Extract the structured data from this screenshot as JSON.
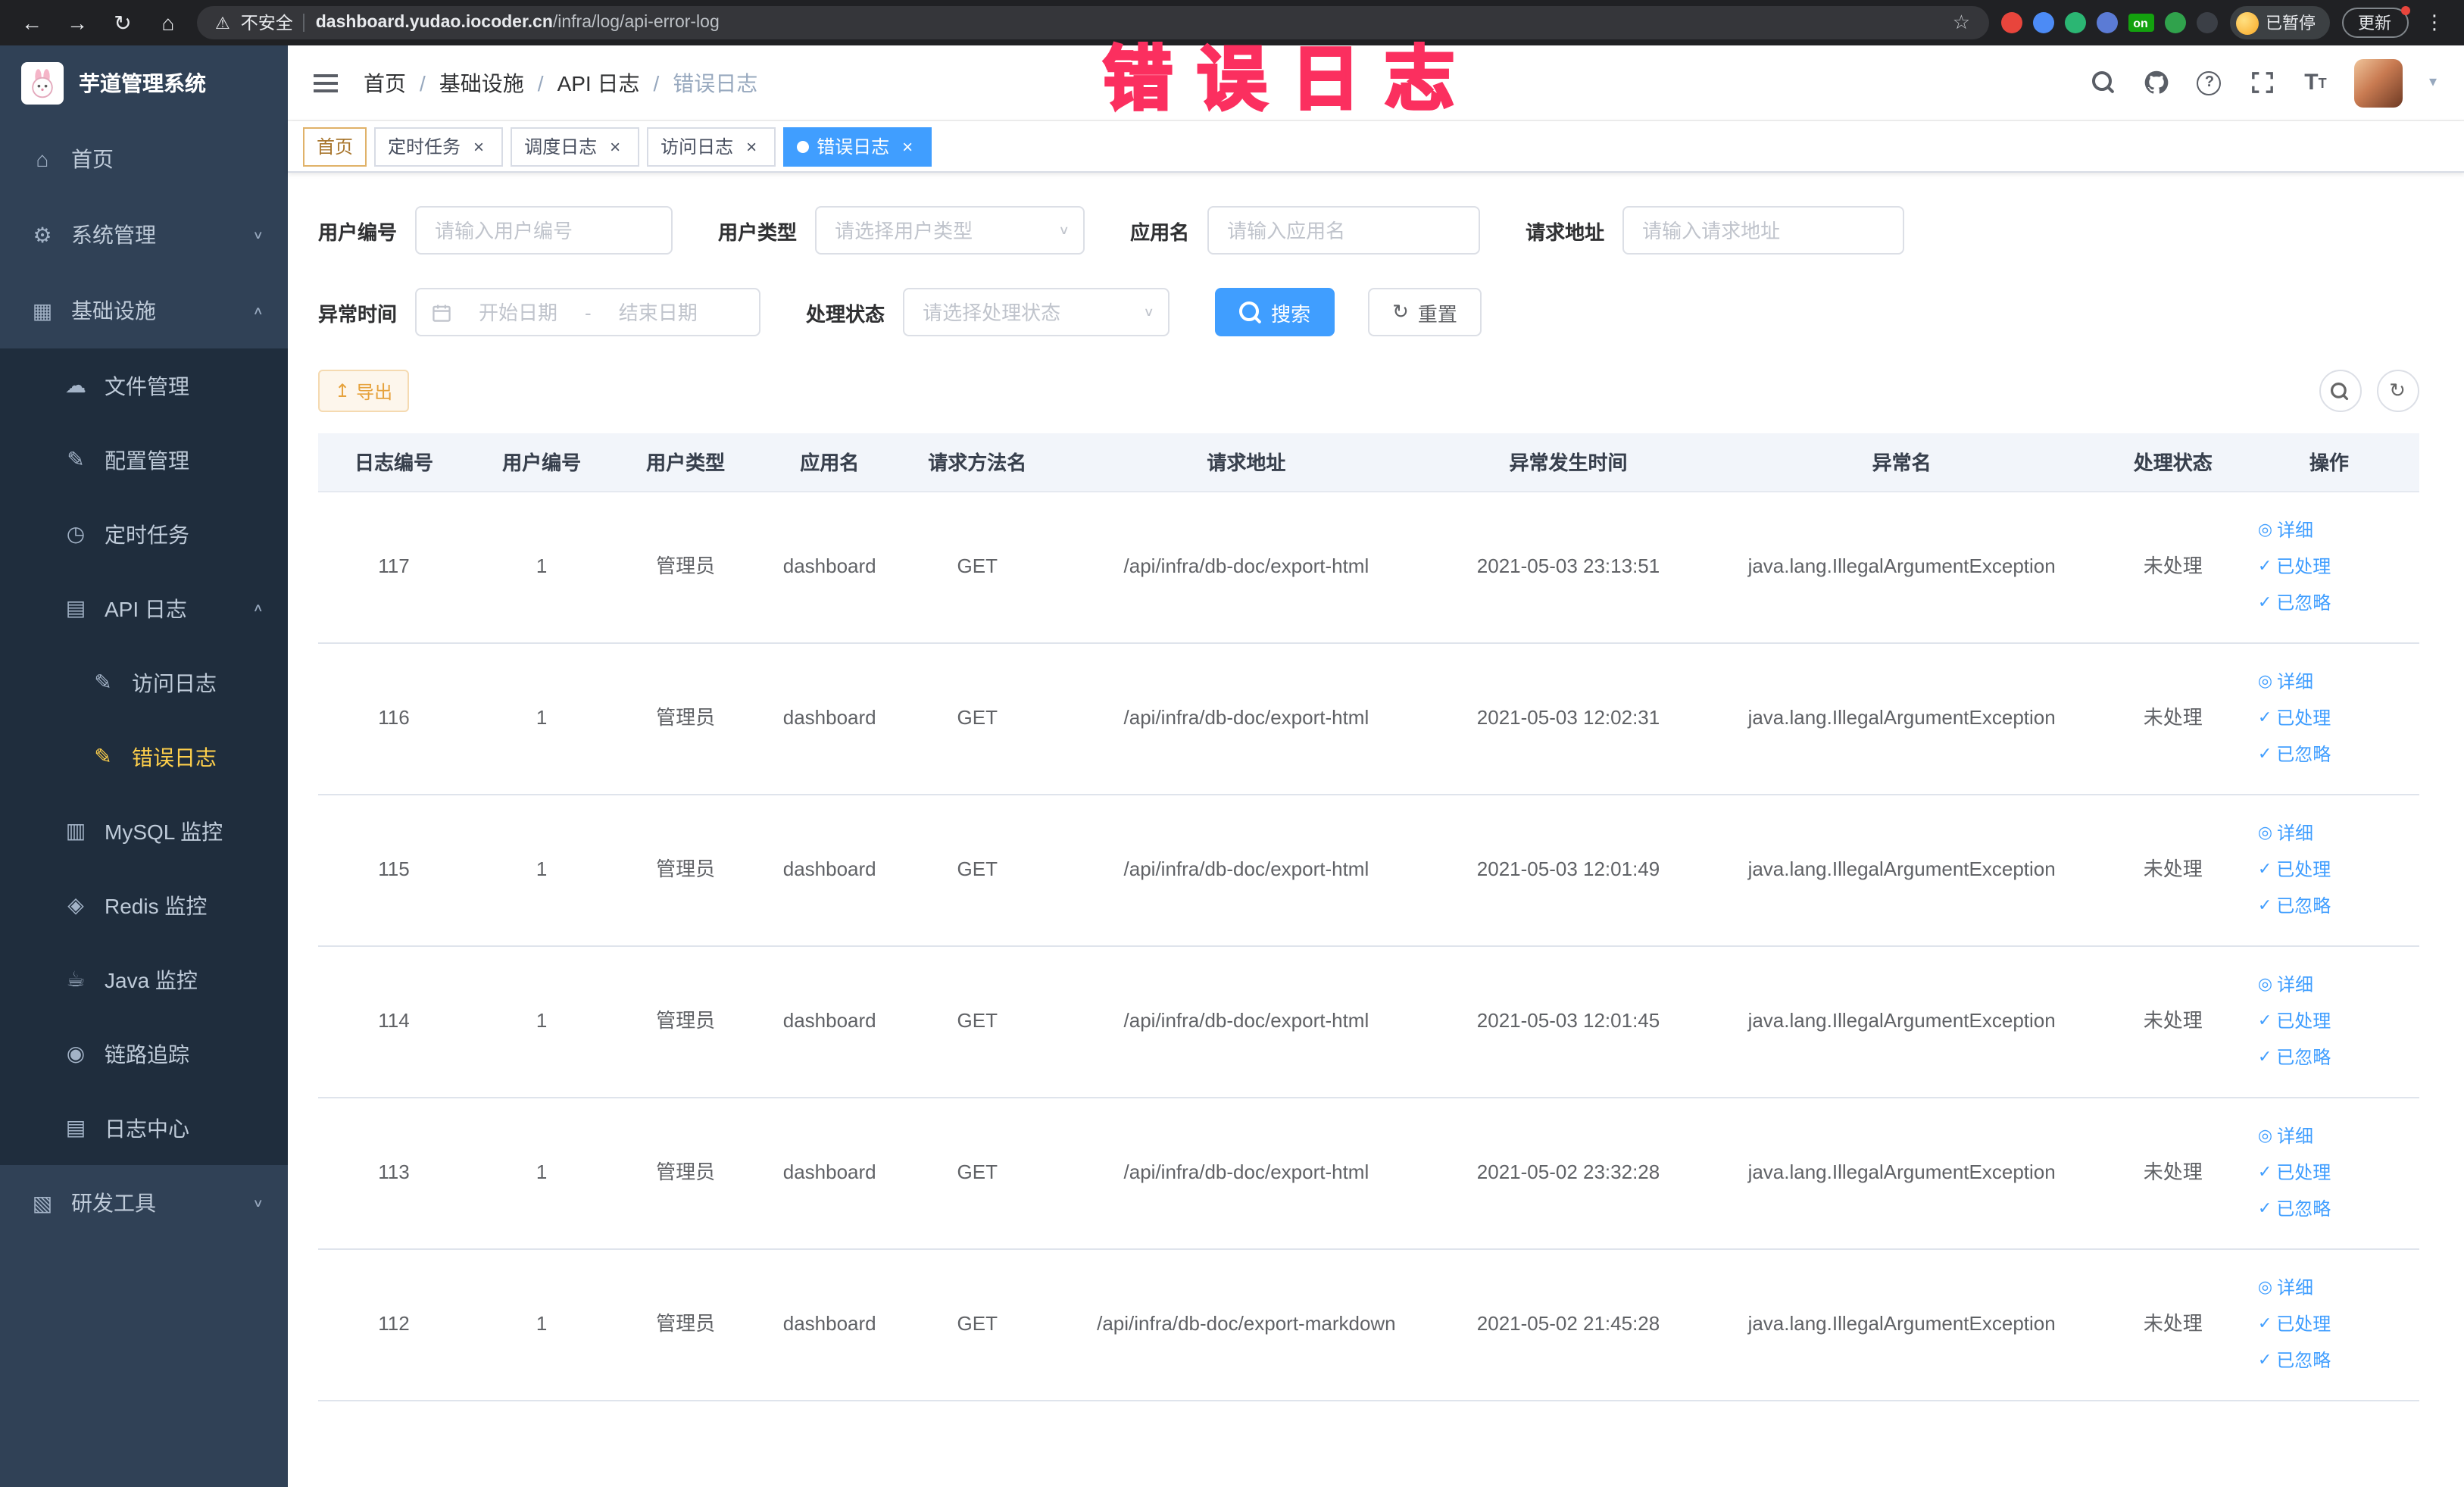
{
  "annotation": {
    "text": "错误日志",
    "color": "#fb2f5f"
  },
  "browser": {
    "security_label": "不安全",
    "url_host": "dashboard.yudao.iocoder.cn",
    "url_path": "/infra/log/api-error-log",
    "profile_badge": "已暂停",
    "update_label": "更新",
    "extension_on_badge": "on"
  },
  "icon_glyphs": {
    "back-icon": "←",
    "forward-icon": "→",
    "reload-icon": "↻",
    "browser-home-icon": "⌂",
    "warning-icon": "⚠",
    "star-icon": "☆",
    "more-icon": "⋮",
    "home-icon": "⌂",
    "gear-icon": "⚙",
    "infra-icon": "▦",
    "cloud-icon": "☁",
    "edit-icon": "✎",
    "timer-icon": "◷",
    "api-log-icon": "▤",
    "doc-icon": "✎",
    "mysql-icon": "▥",
    "redis-icon": "◈",
    "java-icon": "☕",
    "trace-icon": "◉",
    "log-center-icon": "▤",
    "tools-icon": "▧",
    "chevron-up-icon": "∧",
    "chevron-down-icon": "∨",
    "caret-down-icon": "▾",
    "help-icon": "?",
    "fontsize-icon": "T",
    "eye-icon": "◎",
    "check-icon": "✓",
    "refresh-icon": "↻",
    "export-icon": "↥",
    "close-icon": "×"
  },
  "sidebar": {
    "app_title": "芋道管理系统",
    "menu": [
      {
        "id": "home",
        "label": "首页",
        "icon": "home-icon",
        "level": 0
      },
      {
        "id": "system",
        "label": "系统管理",
        "icon": "gear-icon",
        "level": 0,
        "chevron": "down"
      },
      {
        "id": "infra",
        "label": "基础设施",
        "icon": "infra-icon",
        "level": 0,
        "chevron": "up"
      },
      {
        "id": "file",
        "label": "文件管理",
        "icon": "cloud-icon",
        "level": 1
      },
      {
        "id": "config",
        "label": "配置管理",
        "icon": "edit-icon",
        "level": 1
      },
      {
        "id": "job",
        "label": "定时任务",
        "icon": "timer-icon",
        "level": 1
      },
      {
        "id": "api-log",
        "label": "API 日志",
        "icon": "api-log-icon",
        "level": 1,
        "chevron": "up"
      },
      {
        "id": "access-log",
        "label": "访问日志",
        "icon": "doc-icon",
        "level": 2
      },
      {
        "id": "error-log",
        "label": "错误日志",
        "icon": "doc-icon",
        "level": 2,
        "active": true
      },
      {
        "id": "mysql",
        "label": "MySQL 监控",
        "icon": "mysql-icon",
        "level": 1
      },
      {
        "id": "redis",
        "label": "Redis 监控",
        "icon": "redis-icon",
        "level": 1
      },
      {
        "id": "java",
        "label": "Java 监控",
        "icon": "java-icon",
        "level": 1
      },
      {
        "id": "trace",
        "label": "链路追踪",
        "icon": "trace-icon",
        "level": 1
      },
      {
        "id": "log-center",
        "label": "日志中心",
        "icon": "log-center-icon",
        "level": 1
      },
      {
        "id": "dev-tools",
        "label": "研发工具",
        "icon": "tools-icon",
        "level": 0,
        "chevron": "down"
      }
    ]
  },
  "header": {
    "breadcrumb": [
      "首页",
      "基础设施",
      "API 日志",
      "错误日志"
    ]
  },
  "tags": [
    {
      "id": "home",
      "label": "首页",
      "closable": false,
      "active": false,
      "accent": true
    },
    {
      "id": "job",
      "label": "定时任务",
      "closable": true,
      "active": false
    },
    {
      "id": "job-log",
      "label": "调度日志",
      "closable": true,
      "active": false
    },
    {
      "id": "access-log",
      "label": "访问日志",
      "closable": true,
      "active": false
    },
    {
      "id": "error-log",
      "label": "错误日志",
      "closable": true,
      "active": true
    }
  ],
  "filters": {
    "user_id": {
      "label": "用户编号",
      "placeholder": "请输入用户编号"
    },
    "user_type": {
      "label": "用户类型",
      "placeholder": "请选择用户类型"
    },
    "app_name": {
      "label": "应用名",
      "placeholder": "请输入应用名"
    },
    "request_url": {
      "label": "请求地址",
      "placeholder": "请输入请求地址"
    },
    "exception_time": {
      "label": "异常时间",
      "start_placeholder": "开始日期",
      "separator": "-",
      "end_placeholder": "结束日期"
    },
    "process_status": {
      "label": "处理状态",
      "placeholder": "请选择处理状态"
    },
    "search_label": "搜索",
    "reset_label": "重置"
  },
  "toolbar": {
    "export_label": "导出"
  },
  "table": {
    "columns": [
      "日志编号",
      "用户编号",
      "用户类型",
      "应用名",
      "请求方法名",
      "请求地址",
      "异常发生时间",
      "异常名",
      "处理状态",
      "操作"
    ],
    "row_actions": [
      {
        "id": "detail",
        "label": "详细",
        "icon": "eye-icon"
      },
      {
        "id": "processed",
        "label": "已处理",
        "icon": "check-icon"
      },
      {
        "id": "ignored",
        "label": "已忽略",
        "icon": "check-icon"
      }
    ],
    "rows": [
      {
        "cells": [
          "117",
          "1",
          "管理员",
          "dashboard",
          "GET",
          "/api/infra/db-doc/export-html",
          "2021-05-03 23:13:51",
          "java.lang.IllegalArgumentException",
          "未处理"
        ]
      },
      {
        "cells": [
          "116",
          "1",
          "管理员",
          "dashboard",
          "GET",
          "/api/infra/db-doc/export-html",
          "2021-05-03 12:02:31",
          "java.lang.IllegalArgumentException",
          "未处理"
        ]
      },
      {
        "cells": [
          "115",
          "1",
          "管理员",
          "dashboard",
          "GET",
          "/api/infra/db-doc/export-html",
          "2021-05-03 12:01:49",
          "java.lang.IllegalArgumentException",
          "未处理"
        ]
      },
      {
        "cells": [
          "114",
          "1",
          "管理员",
          "dashboard",
          "GET",
          "/api/infra/db-doc/export-html",
          "2021-05-03 12:01:45",
          "java.lang.IllegalArgumentException",
          "未处理"
        ]
      },
      {
        "cells": [
          "113",
          "1",
          "管理员",
          "dashboard",
          "GET",
          "/api/infra/db-doc/export-html",
          "2021-05-02 23:32:28",
          "java.lang.IllegalArgumentException",
          "未处理"
        ]
      },
      {
        "cells": [
          "112",
          "1",
          "管理员",
          "dashboard",
          "GET",
          "/api/infra/db-doc/export-markdown",
          "2021-05-02 21:45:28",
          "java.lang.IllegalArgumentException",
          "未处理"
        ]
      }
    ]
  }
}
